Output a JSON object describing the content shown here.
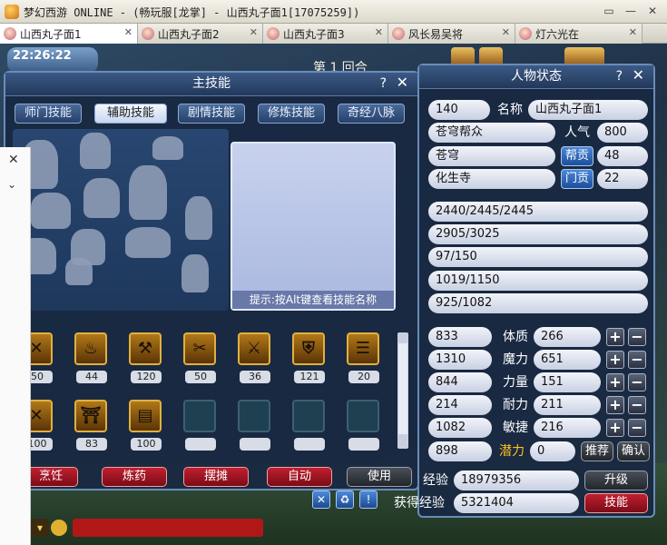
{
  "window": {
    "title": "梦幻西游 ONLINE - (畅玩服[龙掌] - 山西丸子面1[17075259])",
    "controls": [
      "▭",
      "—",
      "✕"
    ]
  },
  "tabs": [
    {
      "label": "山西丸子面1",
      "active": true
    },
    {
      "label": "山西丸子面2",
      "active": false
    },
    {
      "label": "山西丸子面3",
      "active": false
    },
    {
      "label": "风长易吴将",
      "active": false
    },
    {
      "label": "灯六光在",
      "active": false
    }
  ],
  "game": {
    "clock": "22:26:22",
    "round": "第 1 回合"
  },
  "skills_panel": {
    "title": "主技能",
    "help": "?",
    "close": "✕",
    "tabs": [
      "师门技能",
      "辅助技能",
      "剧情技能",
      "修炼技能",
      "奇经八脉"
    ],
    "active_tab": "辅助技能",
    "hint": "提示:按Alt键查看技能名称",
    "icons_row1": [
      "50",
      "44",
      "120",
      "50",
      "36",
      "121",
      "20"
    ],
    "icons_row2": [
      "100",
      "83",
      "100",
      "",
      "",
      "",
      ""
    ],
    "buttons": [
      "烹饪",
      "炼药",
      "摆摊",
      "自动",
      "使用"
    ]
  },
  "status_panel": {
    "title": "人物状态",
    "help": "?",
    "close": "✕",
    "level": "140",
    "name_label": "名称",
    "name": "山西丸子面1",
    "guild": "苍穹帮众",
    "popularity_label": "人气",
    "popularity": "800",
    "faction": "苍穹",
    "contribution_label": "帮贡",
    "contribution": "48",
    "sect": "化生寺",
    "sect_contrib_label": "门贡",
    "sect_contrib": "22",
    "bars": [
      "2440/2445/2445",
      "2905/3025",
      "97/150",
      "1019/1150",
      "925/1082"
    ],
    "attributes": [
      {
        "value": "833",
        "label": "体质",
        "points": "266"
      },
      {
        "value": "1310",
        "label": "魔力",
        "points": "651"
      },
      {
        "value": "844",
        "label": "力量",
        "points": "151"
      },
      {
        "value": "214",
        "label": "耐力",
        "points": "211"
      },
      {
        "value": "1082",
        "label": "敏捷",
        "points": "216"
      }
    ],
    "potential_value": "898",
    "potential_label": "潜力",
    "potential": "0",
    "recommend": "推荐",
    "confirm": "确认",
    "exp_label": "经验",
    "exp": "18979356",
    "upgrade": "升级",
    "gained_label": "获得经验",
    "gained": "5321404",
    "skill_btn": "技能"
  },
  "colors": {
    "accent_blue": "#4a88d8",
    "accent_red": "#c02030",
    "gold": "#ffc020"
  }
}
